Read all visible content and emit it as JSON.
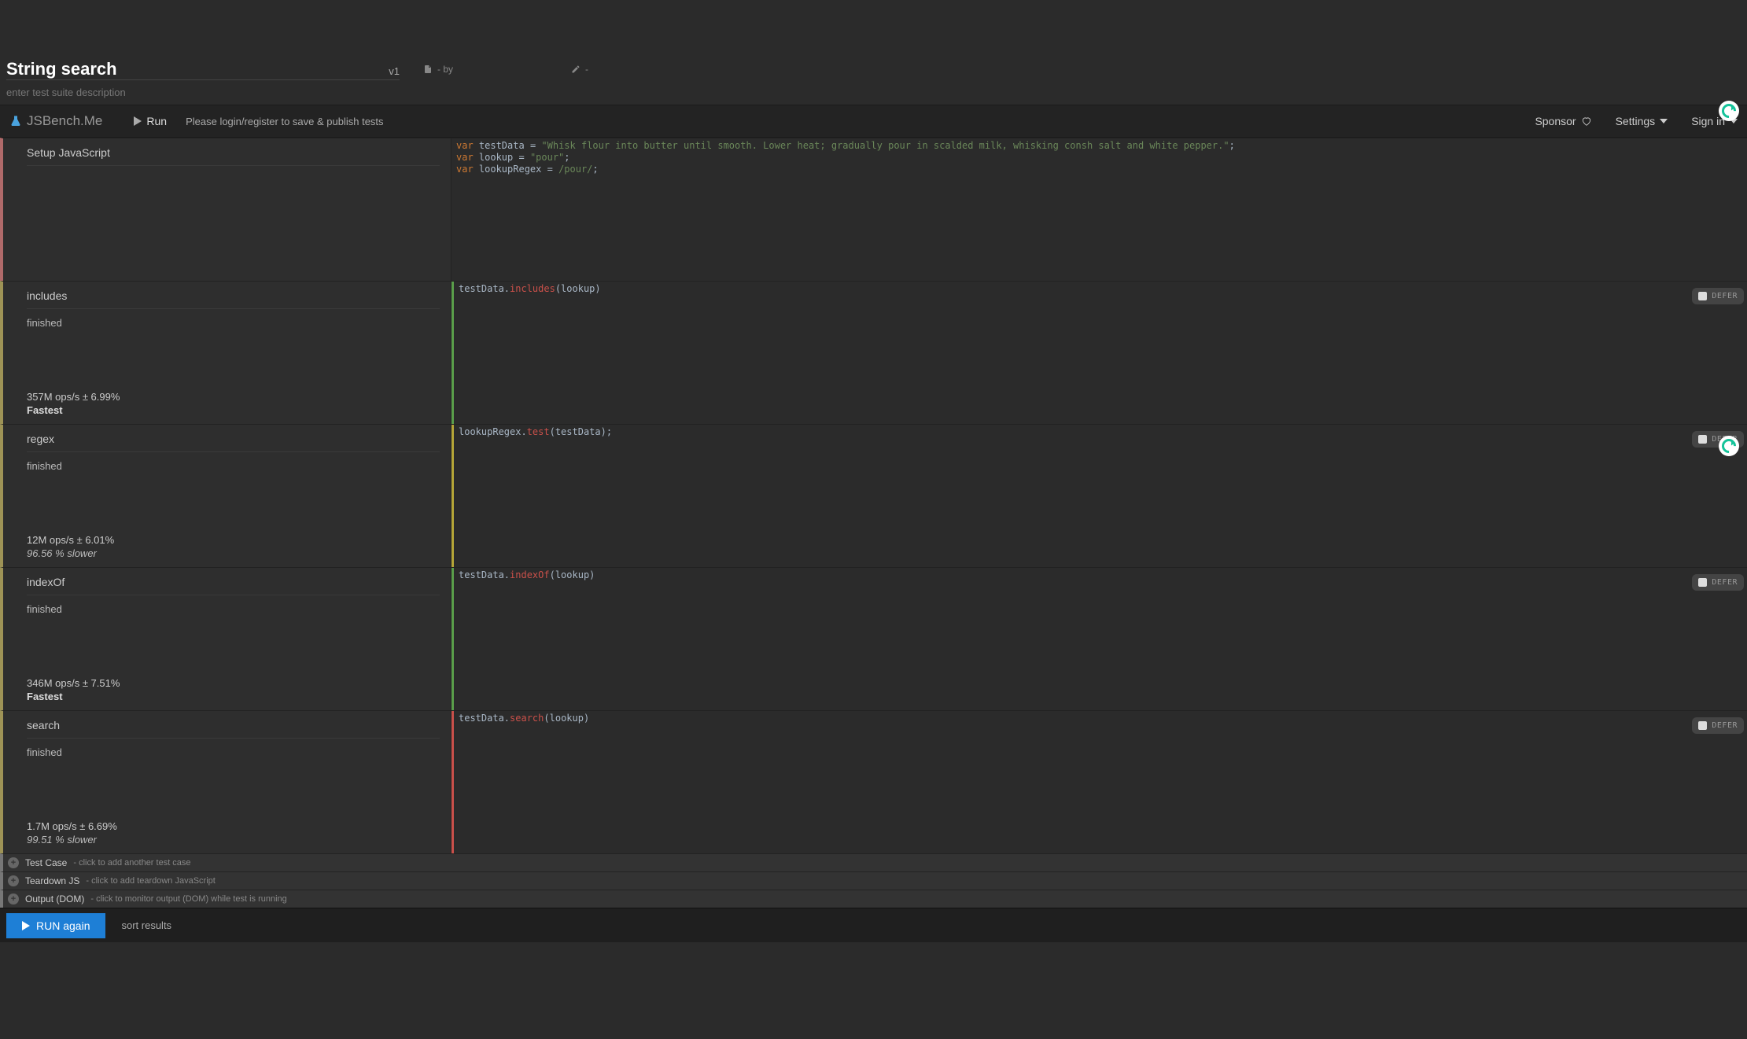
{
  "title": "String search",
  "version": "v1",
  "meta_by": "- by",
  "meta_edit": "-",
  "desc_placeholder": "enter test suite description",
  "logo": "JSBench.Me",
  "run_label": "Run",
  "login_msg": "Please login/register to save & publish tests",
  "toolbar": {
    "sponsor": "Sponsor",
    "settings": "Settings",
    "signin": "Sign in"
  },
  "setup": {
    "title": "Setup JavaScript",
    "code": {
      "l1_var": "var",
      "l1_ident": " testData ",
      "l1_eq": "= ",
      "l1_str": "\"Whisk flour into butter until smooth. Lower heat; gradually pour in scalded milk, whisking consh salt and white pepper.\"",
      "l1_semi": ";",
      "l2_var": "var",
      "l2_ident": " lookup ",
      "l2_eq": "= ",
      "l2_str": "\"pour\"",
      "l2_semi": ";",
      "l3_var": "var",
      "l3_ident": " lookupRegex ",
      "l3_eq": "= ",
      "l3_rgx": "/pour/",
      "l3_semi": ";"
    }
  },
  "tests": [
    {
      "name": "includes",
      "status": "finished",
      "ops": "357M ops/s ± 6.99%",
      "result": "Fastest",
      "result_class": "fastest",
      "bar": "green",
      "code_obj": "testData.",
      "code_fn": "includes",
      "code_args": "(lookup)",
      "defer": "DEFER"
    },
    {
      "name": "regex",
      "status": "finished",
      "ops": "12M ops/s ± 6.01%",
      "result": "96.56 % slower",
      "result_class": "slower",
      "bar": "yellow",
      "code_obj": "lookupRegex.",
      "code_fn": "test",
      "code_args": "(testData);",
      "defer": "DEFER"
    },
    {
      "name": "indexOf",
      "status": "finished",
      "ops": "346M ops/s ± 7.51%",
      "result": "Fastest",
      "result_class": "fastest",
      "bar": "green",
      "code_obj": "testData.",
      "code_fn": "indexOf",
      "code_args": "(lookup)",
      "defer": "DEFER"
    },
    {
      "name": "search",
      "status": "finished",
      "ops": "1.7M ops/s ± 6.69%",
      "result": "99.51 % slower",
      "result_class": "slower",
      "bar": "red",
      "code_obj": "testData.",
      "code_fn": "search",
      "code_args": "(lookup)",
      "defer": "DEFER"
    }
  ],
  "footers": [
    {
      "main": "Test Case",
      "hint": "- click to add another test case"
    },
    {
      "main": "Teardown JS",
      "hint": "- click to add teardown JavaScript"
    },
    {
      "main": "Output (DOM)",
      "hint": "- click to monitor output (DOM) while test is running"
    }
  ],
  "run_again": "RUN again",
  "sort": "sort results"
}
